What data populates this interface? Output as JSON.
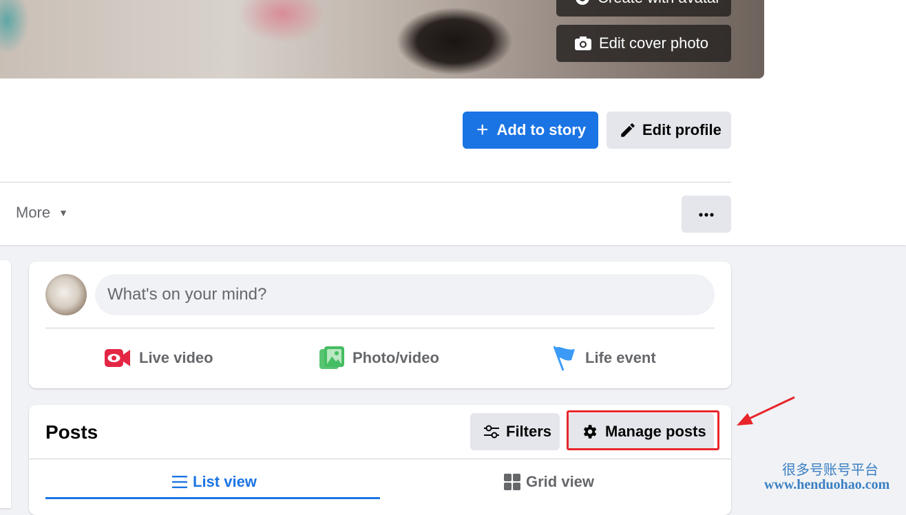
{
  "cover": {
    "create_avatar_label": "Create with avatar",
    "edit_cover_label": "Edit cover photo"
  },
  "profile_actions": {
    "add_story_label": "Add to story",
    "edit_profile_label": "Edit profile"
  },
  "tabs": {
    "more_label": "More",
    "more_caret": "▼"
  },
  "composer": {
    "placeholder": "What's on your mind?",
    "live_video_label": "Live video",
    "photo_video_label": "Photo/video",
    "life_event_label": "Life event"
  },
  "posts": {
    "title": "Posts",
    "filters_label": "Filters",
    "manage_posts_label": "Manage posts",
    "list_view_label": "List view",
    "grid_view_label": "Grid view",
    "active_view": "List view"
  },
  "colors": {
    "accent": "#1b74e4",
    "highlight_box": "#e8252b",
    "annotation_arrow": "#e8252b",
    "live_video_icon": "#e42645",
    "photo_icon": "#45bd62",
    "life_event_icon": "#3b9af5"
  },
  "watermark": {
    "line1": "很多号账号平台",
    "line2": "www.henduohao.com"
  }
}
